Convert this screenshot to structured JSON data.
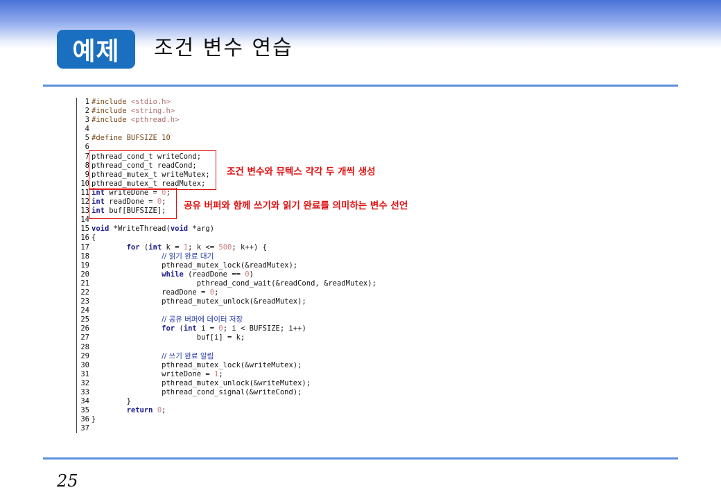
{
  "header": {
    "badge": "예제",
    "title": "조건 변수 연습"
  },
  "annotations": {
    "first": "조건 변수와 뮤텍스 각각 두 개씩 생성",
    "second": "공유 버퍼와 함께 쓰기와 읽기 완료를 의미하는 변수 선언"
  },
  "footer": {
    "page_number": "25"
  },
  "code_lines": [
    {
      "n": "1",
      "t": [
        [
          "pp",
          "#include "
        ],
        [
          "str",
          "<stdio.h>"
        ]
      ]
    },
    {
      "n": "2",
      "t": [
        [
          "pp",
          "#include "
        ],
        [
          "str",
          "<string.h>"
        ]
      ]
    },
    {
      "n": "3",
      "t": [
        [
          "pp",
          "#include "
        ],
        [
          "str",
          "<pthread.h>"
        ]
      ]
    },
    {
      "n": "4",
      "t": []
    },
    {
      "n": "5",
      "t": [
        [
          "pp",
          "#define BUFSIZE 10"
        ]
      ]
    },
    {
      "n": "6",
      "t": []
    },
    {
      "n": "7",
      "t": [
        [
          "",
          "pthread_cond_t writeCond;"
        ]
      ]
    },
    {
      "n": "8",
      "t": [
        [
          "",
          "pthread_cond_t readCond;"
        ]
      ]
    },
    {
      "n": "9",
      "t": [
        [
          "",
          "pthread_mutex_t writeMutex;"
        ]
      ]
    },
    {
      "n": "10",
      "t": [
        [
          "",
          "pthread_mutex_t readMutex;"
        ]
      ]
    },
    {
      "n": "11",
      "t": [
        [
          "kw",
          "int"
        ],
        [
          "",
          " writeDone = "
        ],
        [
          "num",
          "0"
        ],
        [
          "",
          ";"
        ]
      ]
    },
    {
      "n": "12",
      "t": [
        [
          "kw",
          "int"
        ],
        [
          "",
          " readDone = "
        ],
        [
          "num",
          "0"
        ],
        [
          "",
          ";"
        ]
      ]
    },
    {
      "n": "13",
      "t": [
        [
          "kw",
          "int"
        ],
        [
          "",
          " buf[BUFSIZE];"
        ]
      ]
    },
    {
      "n": "14",
      "t": []
    },
    {
      "n": "15",
      "t": [
        [
          "kw",
          "void"
        ],
        [
          "",
          " *WriteThread("
        ],
        [
          "kw",
          "void"
        ],
        [
          "",
          " *arg)"
        ]
      ]
    },
    {
      "n": "16",
      "t": [
        [
          "",
          "{"
        ]
      ]
    },
    {
      "n": "17",
      "t": [
        [
          "",
          "        "
        ],
        [
          "kw",
          "for"
        ],
        [
          "",
          " ("
        ],
        [
          "kw",
          "int"
        ],
        [
          "",
          " k = "
        ],
        [
          "num",
          "1"
        ],
        [
          "",
          "; k <= "
        ],
        [
          "num",
          "500"
        ],
        [
          "",
          "; k++) {"
        ]
      ]
    },
    {
      "n": "18",
      "t": [
        [
          "",
          "                "
        ],
        [
          "cmt",
          "// 읽기 완료 대기"
        ]
      ]
    },
    {
      "n": "19",
      "t": [
        [
          "",
          "                pthread_mutex_lock(&readMutex);"
        ]
      ]
    },
    {
      "n": "20",
      "t": [
        [
          "",
          "                "
        ],
        [
          "kw",
          "while"
        ],
        [
          "",
          " (readDone == "
        ],
        [
          "num",
          "0"
        ],
        [
          "",
          ")"
        ]
      ]
    },
    {
      "n": "21",
      "t": [
        [
          "",
          "                        pthread_cond_wait(&readCond, &readMutex);"
        ]
      ]
    },
    {
      "n": "22",
      "t": [
        [
          "",
          "                readDone = "
        ],
        [
          "num",
          "0"
        ],
        [
          "",
          ";"
        ]
      ]
    },
    {
      "n": "23",
      "t": [
        [
          "",
          "                pthread_mutex_unlock(&readMutex);"
        ]
      ]
    },
    {
      "n": "24",
      "t": []
    },
    {
      "n": "25",
      "t": [
        [
          "",
          "                "
        ],
        [
          "cmt",
          "// 공유 버퍼에 데이터 저장"
        ]
      ]
    },
    {
      "n": "26",
      "t": [
        [
          "",
          "                "
        ],
        [
          "kw",
          "for"
        ],
        [
          "",
          " ("
        ],
        [
          "kw",
          "int"
        ],
        [
          "",
          " i = "
        ],
        [
          "num",
          "0"
        ],
        [
          "",
          "; i < BUFSIZE; i++)"
        ]
      ]
    },
    {
      "n": "27",
      "t": [
        [
          "",
          "                        buf[i] = k;"
        ]
      ]
    },
    {
      "n": "28",
      "t": []
    },
    {
      "n": "29",
      "t": [
        [
          "",
          "                "
        ],
        [
          "cmt",
          "// 쓰기 완료 알림"
        ]
      ]
    },
    {
      "n": "30",
      "t": [
        [
          "",
          "                pthread_mutex_lock(&writeMutex);"
        ]
      ]
    },
    {
      "n": "31",
      "t": [
        [
          "",
          "                writeDone = "
        ],
        [
          "num",
          "1"
        ],
        [
          "",
          ";"
        ]
      ]
    },
    {
      "n": "32",
      "t": [
        [
          "",
          "                pthread_mutex_unlock(&writeMutex);"
        ]
      ]
    },
    {
      "n": "33",
      "t": [
        [
          "",
          "                pthread_cond_signal(&writeCond);"
        ]
      ]
    },
    {
      "n": "34",
      "t": [
        [
          "",
          "        }"
        ]
      ]
    },
    {
      "n": "35",
      "t": [
        [
          "",
          "        "
        ],
        [
          "kw",
          "return"
        ],
        [
          "",
          " "
        ],
        [
          "num",
          "0"
        ],
        [
          "",
          ";"
        ]
      ]
    },
    {
      "n": "36",
      "t": [
        [
          "",
          "}"
        ]
      ]
    },
    {
      "n": "37",
      "t": []
    }
  ]
}
